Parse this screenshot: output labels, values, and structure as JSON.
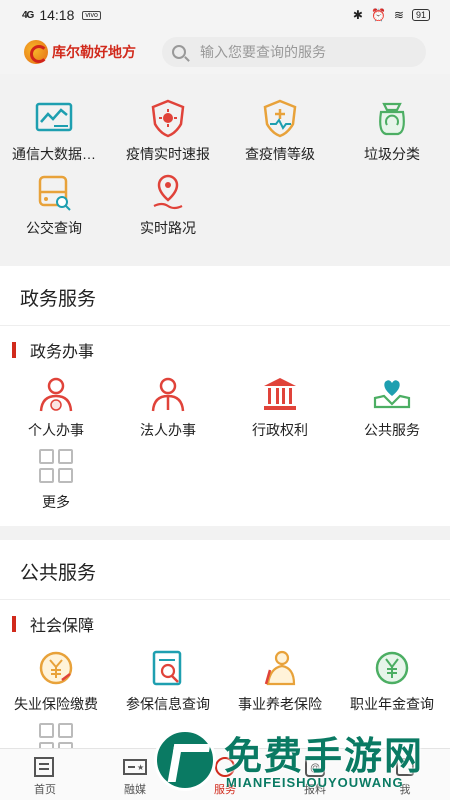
{
  "status_bar": {
    "signal": "4G",
    "time": "14:18",
    "badge": "vivo",
    "battery": "91"
  },
  "search": {
    "brand": "库尔勒好地方",
    "placeholder": "输入您要查询的服务"
  },
  "quick_services": [
    {
      "label": "通信大数据…",
      "icon": "data-chart-icon"
    },
    {
      "label": "疫情实时速报",
      "icon": "virus-shield-icon"
    },
    {
      "label": "查疫情等级",
      "icon": "medical-shield-icon"
    },
    {
      "label": "垃圾分类",
      "icon": "recycle-bag-icon"
    },
    {
      "label": "公交查询",
      "icon": "bus-icon"
    },
    {
      "label": "实时路况",
      "icon": "location-pin-icon"
    }
  ],
  "gov_section": {
    "title": "政务服务",
    "subtitle": "政务办事",
    "items": [
      {
        "label": "个人办事",
        "icon": "person-icon"
      },
      {
        "label": "法人办事",
        "icon": "corporate-person-icon"
      },
      {
        "label": "行政权利",
        "icon": "government-building-icon"
      },
      {
        "label": "公共服务",
        "icon": "hands-heart-icon"
      },
      {
        "label": "更多",
        "icon": "grid-more-icon"
      }
    ]
  },
  "public_section": {
    "title": "公共服务",
    "subtitle": "社会保障",
    "items": [
      {
        "label": "失业保险缴费",
        "icon": "coin-icon"
      },
      {
        "label": "参保信息查询",
        "icon": "search-document-icon"
      },
      {
        "label": "事业养老保险",
        "icon": "elder-icon"
      },
      {
        "label": "职业年金查询",
        "icon": "yuan-coin-icon"
      }
    ]
  },
  "tabbar": [
    {
      "label": "首页",
      "icon": "newspaper-icon"
    },
    {
      "label": "融媒",
      "icon": "media-icon"
    },
    {
      "label": "服务",
      "icon": "service-icon",
      "active": true
    },
    {
      "label": "报料",
      "icon": "report-icon"
    },
    {
      "label": "我",
      "icon": "profile-icon"
    }
  ],
  "watermark": {
    "title": "免费手游网",
    "subtitle": "MIANFEISHOUYOUWANG"
  },
  "colors": {
    "accent": "#d12a1c",
    "icon_red": "#e0433a",
    "icon_orange": "#e8a23a",
    "icon_teal": "#1e9fb0",
    "icon_green": "#4cae63",
    "watermark": "#0a7a63"
  }
}
